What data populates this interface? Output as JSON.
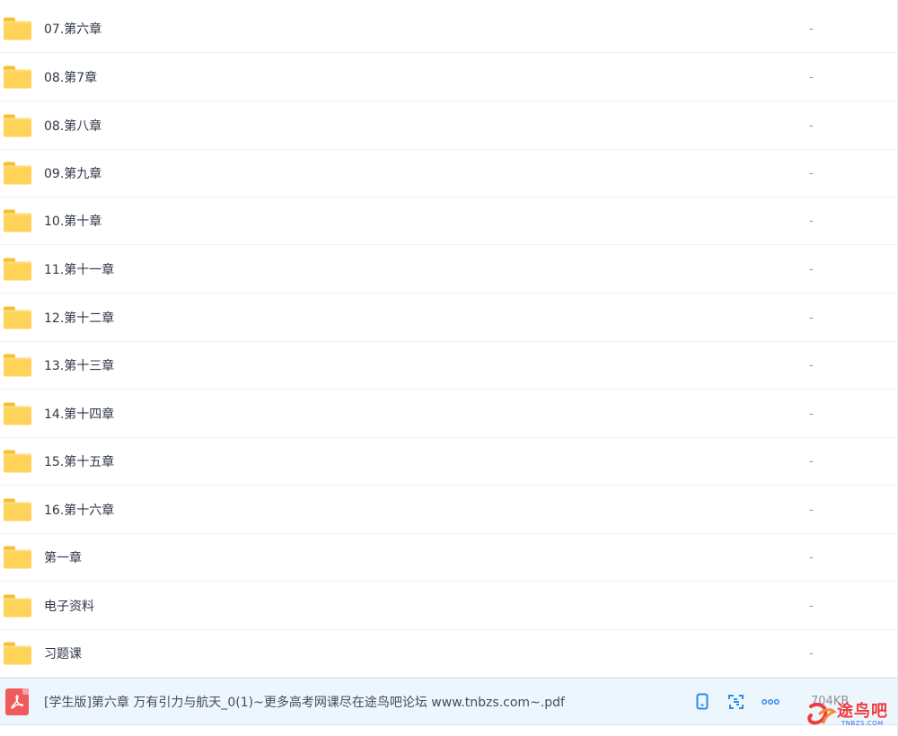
{
  "folders": [
    {
      "name": "07.第六章",
      "size": "-"
    },
    {
      "name": "08.第7章",
      "size": "-"
    },
    {
      "name": "08.第八章",
      "size": "-"
    },
    {
      "name": "09.第九章",
      "size": "-"
    },
    {
      "name": "10.第十章",
      "size": "-"
    },
    {
      "name": "11.第十一章",
      "size": "-"
    },
    {
      "name": "12.第十二章",
      "size": "-"
    },
    {
      "name": "13.第十三章",
      "size": "-"
    },
    {
      "name": "14.第十四章",
      "size": "-"
    },
    {
      "name": "15.第十五章",
      "size": "-"
    },
    {
      "name": "16.第十六章",
      "size": "-"
    },
    {
      "name": "第一章",
      "size": "-"
    },
    {
      "name": "电子资料",
      "size": "-"
    },
    {
      "name": "习题课",
      "size": "-"
    }
  ],
  "file": {
    "name": "[学生版]第六章 万有引力与航天_0(1)~更多高考网课尽在途鸟吧论坛 www.tnbzs.com~.pdf",
    "size": "704KB",
    "icon": "pdf-icon",
    "actions": [
      "phone-icon",
      "scan-icon",
      "more-icon"
    ]
  },
  "watermark": {
    "text": "途鸟吧",
    "sub": "TNBZS.COM",
    "color": "#ef3d3d"
  },
  "colors": {
    "folder": "#ffd25a",
    "selected_row": "#eef6fd",
    "action_blue": "#2a8ce5",
    "pdf_red": "#ef5a5a"
  }
}
